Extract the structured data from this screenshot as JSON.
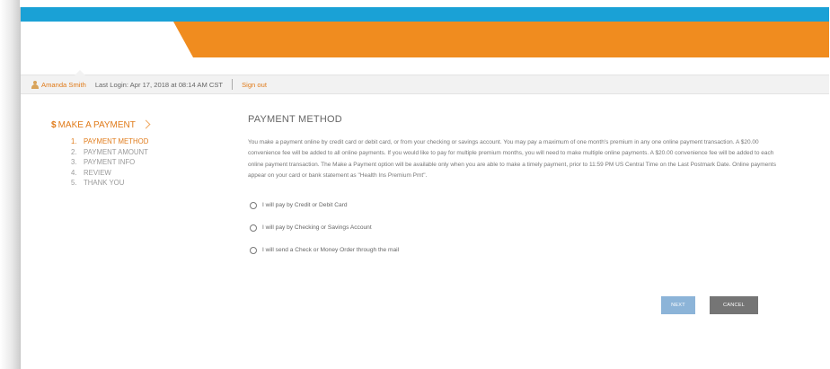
{
  "user_bar": {
    "user_name": "Amanda Smith",
    "last_login": "Last Login: Apr 17, 2018 at 08:14 AM CST",
    "sign_out": "Sign out"
  },
  "sidebar": {
    "title": "MAKE A PAYMENT",
    "steps": [
      {
        "num": "1.",
        "label": "PAYMENT METHOD",
        "active": true
      },
      {
        "num": "2.",
        "label": "PAYMENT AMOUNT",
        "active": false
      },
      {
        "num": "3.",
        "label": "PAYMENT INFO",
        "active": false
      },
      {
        "num": "4.",
        "label": "REVIEW",
        "active": false
      },
      {
        "num": "5.",
        "label": "THANK YOU",
        "active": false
      }
    ]
  },
  "main": {
    "title": "PAYMENT METHOD",
    "description": "You make a payment online by credit card or debit card, or from your checking or savings account. You may pay a maximum of one month's premium in any one online payment transaction. A $20.00 convenience fee will be added to all online payments. If you would like to pay for multiple premium months, you will need to make multiple online payments. A $20.00 convenience fee will be added to each online payment transaction. The Make a Payment option will be available only when you are able to make a timely payment, prior to 11:59 PM US Central Time on the Last Postmark Date. Online payments appear on your card or bank statement as \"Health Ins Premium Pmt\".",
    "options": [
      "I will pay by Credit or Debit Card",
      "I will pay by Checking or Savings Account",
      "I will send a Check or Money Order through the mail"
    ],
    "next_label": "NEXT",
    "cancel_label": "CANCEL"
  },
  "colors": {
    "top_bar": "#1aa1d6",
    "orange_band": "#f08c1f",
    "accent": "#e07b1a",
    "next_button": "#8cb4d8",
    "cancel_button": "#757575"
  },
  "icons": [
    "user-icon",
    "dollar-icon",
    "chevron-right-icon"
  ]
}
